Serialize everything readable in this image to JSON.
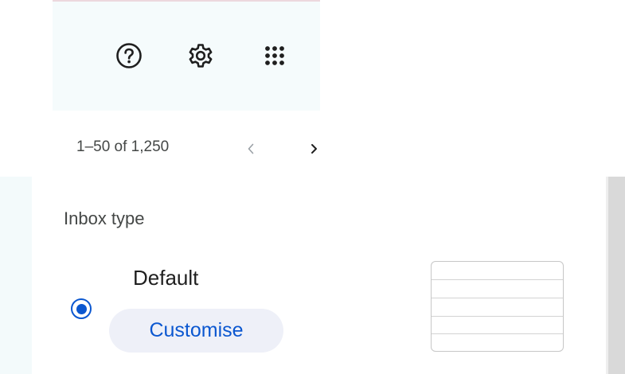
{
  "toolbar": {
    "icons": [
      {
        "name": "help-icon",
        "label": "Support"
      },
      {
        "name": "gear-icon",
        "label": "Settings"
      },
      {
        "name": "apps-grid-icon",
        "label": "Google apps"
      }
    ]
  },
  "pagination": {
    "range_text": "1–50 of 1,250",
    "prev_icon": "chevron-left-icon",
    "next_icon": "chevron-right-icon"
  },
  "inbox_type": {
    "title": "Inbox type",
    "options": [
      {
        "label": "Default",
        "selected": true,
        "action_label": "Customise"
      }
    ],
    "preview_icon": "inbox-layout-preview"
  },
  "colors": {
    "accent": "#0b57d0",
    "toolbar_bg": "#f5fbfc",
    "chip_bg": "#eef0f8",
    "icon": "#1f1f1f"
  }
}
